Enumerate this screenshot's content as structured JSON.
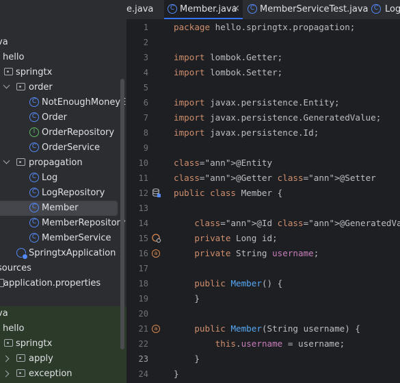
{
  "tabs": [
    {
      "label": "e.java",
      "active": false
    },
    {
      "label": "Member.java",
      "active": true
    },
    {
      "label": "MemberServiceTest.java",
      "active": false
    },
    {
      "label": "Log",
      "active": false
    }
  ],
  "tab_close_glyph": "×",
  "tree": {
    "items": [
      {
        "label": "va"
      },
      {
        "label": "hello"
      },
      {
        "label": "springtx",
        "icon": "package-icon"
      },
      {
        "label": "order",
        "icon": "package-icon"
      },
      {
        "label": "NotEnoughMoneyE",
        "icon": "class-icon"
      },
      {
        "label": "Order",
        "icon": "class-icon"
      },
      {
        "label": "OrderRepository",
        "icon": "interface-icon"
      },
      {
        "label": "OrderService",
        "icon": "class-icon"
      },
      {
        "label": "propagation",
        "icon": "package-icon"
      },
      {
        "label": "Log",
        "icon": "class-icon"
      },
      {
        "label": "LogRepository",
        "icon": "class-icon"
      },
      {
        "label": "Member",
        "icon": "class-icon",
        "selected": true
      },
      {
        "label": "MemberRepository",
        "icon": "class-icon"
      },
      {
        "label": "MemberService",
        "icon": "class-icon"
      },
      {
        "label": "SpringtxApplication",
        "icon": "spring-app-icon"
      },
      {
        "label": "sources"
      },
      {
        "label": "application.properties",
        "icon": "file-icon"
      },
      {
        "label": "va"
      },
      {
        "label": "hello"
      },
      {
        "label": "springtx",
        "icon": "package-icon"
      },
      {
        "label": "apply",
        "icon": "package-icon"
      },
      {
        "label": "exception",
        "icon": "package-icon"
      }
    ]
  },
  "icon_glyphs": {
    "class": "C",
    "interface": "I",
    "autowired": "a"
  },
  "editor": {
    "current_line": 23,
    "lines": [
      {
        "n": "1",
        "code": "package hello.springtx.propagation;"
      },
      {
        "n": "2",
        "code": ""
      },
      {
        "n": "3",
        "code": "import lombok.Getter;"
      },
      {
        "n": "4",
        "code": "import lombok.Setter;"
      },
      {
        "n": "5",
        "code": ""
      },
      {
        "n": "6",
        "code": "import javax.persistence.Entity;"
      },
      {
        "n": "7",
        "code": "import javax.persistence.GeneratedValue;"
      },
      {
        "n": "8",
        "code": "import javax.persistence.Id;"
      },
      {
        "n": "9",
        "code": ""
      },
      {
        "n": "10",
        "code": "@Entity"
      },
      {
        "n": "11",
        "code": "@Getter @Setter"
      },
      {
        "n": "12",
        "code": "public class Member {"
      },
      {
        "n": "13",
        "code": ""
      },
      {
        "n": "14",
        "code": "    @Id @GeneratedValue"
      },
      {
        "n": "15",
        "code": "    private Long id;"
      },
      {
        "n": "16",
        "code": "    private String username;"
      },
      {
        "n": "17",
        "code": ""
      },
      {
        "n": "18",
        "code": "    public Member() {"
      },
      {
        "n": "19",
        "code": "    }"
      },
      {
        "n": "20",
        "code": ""
      },
      {
        "n": "21",
        "code": "    public Member(String username) {"
      },
      {
        "n": "22",
        "code": "        this.username = username;"
      },
      {
        "n": "23",
        "code": "    }"
      },
      {
        "n": "24",
        "code": "}"
      }
    ]
  },
  "colors": {
    "keyword": "#cf8e6d",
    "annotation": "#b3ae60",
    "field": "#c77dbb",
    "method": "#56a8f5",
    "text": "#bcbec4",
    "accent": "#3574f0"
  }
}
